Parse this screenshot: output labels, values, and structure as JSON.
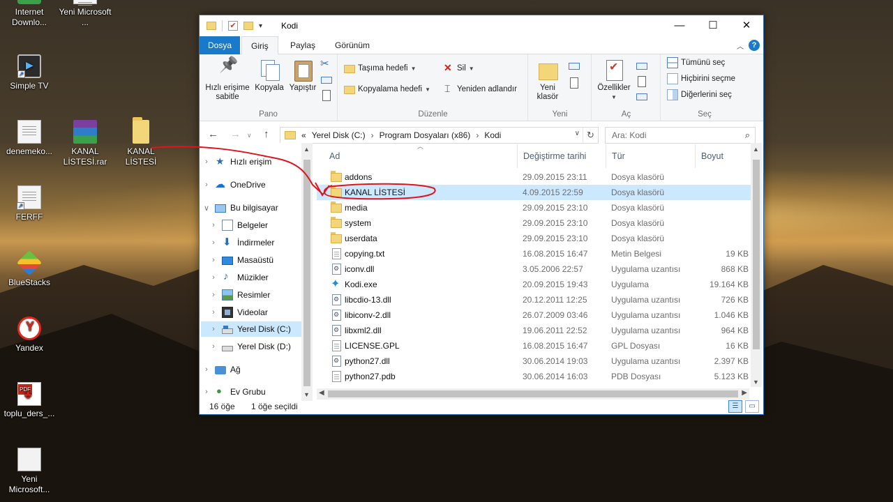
{
  "desktop": {
    "icons": [
      {
        "label": "Internet Downlo...",
        "icon": "download-icon"
      },
      {
        "label": "Yeni Microsoft ...",
        "icon": "document-icon"
      },
      {
        "label": "Simple TV",
        "icon": "tv-icon"
      },
      {
        "label": "denemeko...",
        "icon": "text-file-icon"
      },
      {
        "label": "KANAL LİSTESİ.rar",
        "icon": "rar-archive-icon"
      },
      {
        "label": "KANAL LİSTESİ",
        "icon": "folder-icon"
      },
      {
        "label": "FERFF",
        "icon": "file-shortcut-icon"
      },
      {
        "label": "BlueStacks",
        "icon": "bluestacks-icon"
      },
      {
        "label": "Yandex",
        "icon": "yandex-icon"
      },
      {
        "label": "toplu_ders_...",
        "icon": "pdf-icon"
      },
      {
        "label": "Yeni Microsoft...",
        "icon": "document-icon"
      }
    ]
  },
  "window": {
    "title": "Kodi",
    "quick_access_caret": "▾",
    "buttons": {
      "minimize": "—",
      "maximize": "☐",
      "close": "✕"
    }
  },
  "ribbon": {
    "tabs": {
      "file": "Dosya",
      "home": "Giriş",
      "share": "Paylaş",
      "view": "Görünüm"
    },
    "help": "?",
    "groups": {
      "clipboard": {
        "label": "Pano",
        "pin": "Hızlı erişime sabitle",
        "copy": "Kopyala",
        "paste": "Yapıştır"
      },
      "organize": {
        "label": "Düzenle",
        "move_to": "Taşıma hedefi",
        "copy_to": "Kopyalama hedefi",
        "delete": "Sil",
        "rename": "Yeniden adlandır"
      },
      "new": {
        "label": "Yeni",
        "new_folder": "Yeni klasör"
      },
      "open": {
        "label": "Aç",
        "properties": "Özellikler"
      },
      "select": {
        "label": "Seç",
        "select_all": "Tümünü seç",
        "select_none": "Hiçbirini seçme",
        "invert": "Diğerlerini seç"
      }
    }
  },
  "address": {
    "prefix": "«",
    "segments": [
      "Yerel Disk (C:)",
      "Program Dosyaları (x86)",
      "Kodi"
    ],
    "search_placeholder": "Ara: Kodi"
  },
  "nav_pane": {
    "items": [
      {
        "label": "Hızlı erişim",
        "icon": "star-icon"
      },
      {
        "label": "OneDrive",
        "icon": "cloud-icon"
      },
      {
        "label": "Bu bilgisayar",
        "icon": "computer-icon"
      },
      {
        "label": "Belgeler",
        "icon": "documents-icon"
      },
      {
        "label": "İndirmeler",
        "icon": "downloads-icon"
      },
      {
        "label": "Masaüstü",
        "icon": "desktop-icon"
      },
      {
        "label": "Müzikler",
        "icon": "music-icon"
      },
      {
        "label": "Resimler",
        "icon": "pictures-icon"
      },
      {
        "label": "Videolar",
        "icon": "videos-icon"
      },
      {
        "label": "Yerel Disk (C:)",
        "icon": "drive-c-icon"
      },
      {
        "label": "Yerel Disk (D:)",
        "icon": "drive-d-icon"
      },
      {
        "label": "Ağ",
        "icon": "network-icon"
      },
      {
        "label": "Ev Grubu",
        "icon": "homegroup-icon"
      }
    ]
  },
  "file_list": {
    "columns": {
      "name": "Ad",
      "modified": "Değiştirme tarihi",
      "type": "Tür",
      "size": "Boyut"
    },
    "rows": [
      {
        "name": "addons",
        "modified": "29.09.2015 23:11",
        "type": "Dosya klasörü",
        "size": ""
      },
      {
        "name": "KANAL LİSTESİ",
        "modified": "4.09.2015 22:59",
        "type": "Dosya klasörü",
        "size": ""
      },
      {
        "name": "media",
        "modified": "29.09.2015 23:10",
        "type": "Dosya klasörü",
        "size": ""
      },
      {
        "name": "system",
        "modified": "29.09.2015 23:10",
        "type": "Dosya klasörü",
        "size": ""
      },
      {
        "name": "userdata",
        "modified": "29.09.2015 23:10",
        "type": "Dosya klasörü",
        "size": ""
      },
      {
        "name": "copying.txt",
        "modified": "16.08.2015 16:47",
        "type": "Metin Belgesi",
        "size": "19 KB"
      },
      {
        "name": "iconv.dll",
        "modified": "3.05.2006 22:57",
        "type": "Uygulama uzantısı",
        "size": "868 KB"
      },
      {
        "name": "Kodi.exe",
        "modified": "20.09.2015 19:43",
        "type": "Uygulama",
        "size": "19.164 KB"
      },
      {
        "name": "libcdio-13.dll",
        "modified": "20.12.2011 12:25",
        "type": "Uygulama uzantısı",
        "size": "726 KB"
      },
      {
        "name": "libiconv-2.dll",
        "modified": "26.07.2009 03:46",
        "type": "Uygulama uzantısı",
        "size": "1.046 KB"
      },
      {
        "name": "libxml2.dll",
        "modified": "19.06.2011 22:52",
        "type": "Uygulama uzantısı",
        "size": "964 KB"
      },
      {
        "name": "LICENSE.GPL",
        "modified": "16.08.2015 16:47",
        "type": "GPL Dosyası",
        "size": "16 KB"
      },
      {
        "name": "python27.dll",
        "modified": "30.06.2014 19:03",
        "type": "Uygulama uzantısı",
        "size": "2.397 KB"
      },
      {
        "name": "python27.pdb",
        "modified": "30.06.2014 16:03",
        "type": "PDB Dosyası",
        "size": "5.123 KB"
      }
    ]
  },
  "status": {
    "count": "16 öğe",
    "selected": "1 öğe seçildi"
  },
  "colors": {
    "accent": "#1979ca",
    "selection": "#cce8ff",
    "annotation": "#e0141c"
  }
}
